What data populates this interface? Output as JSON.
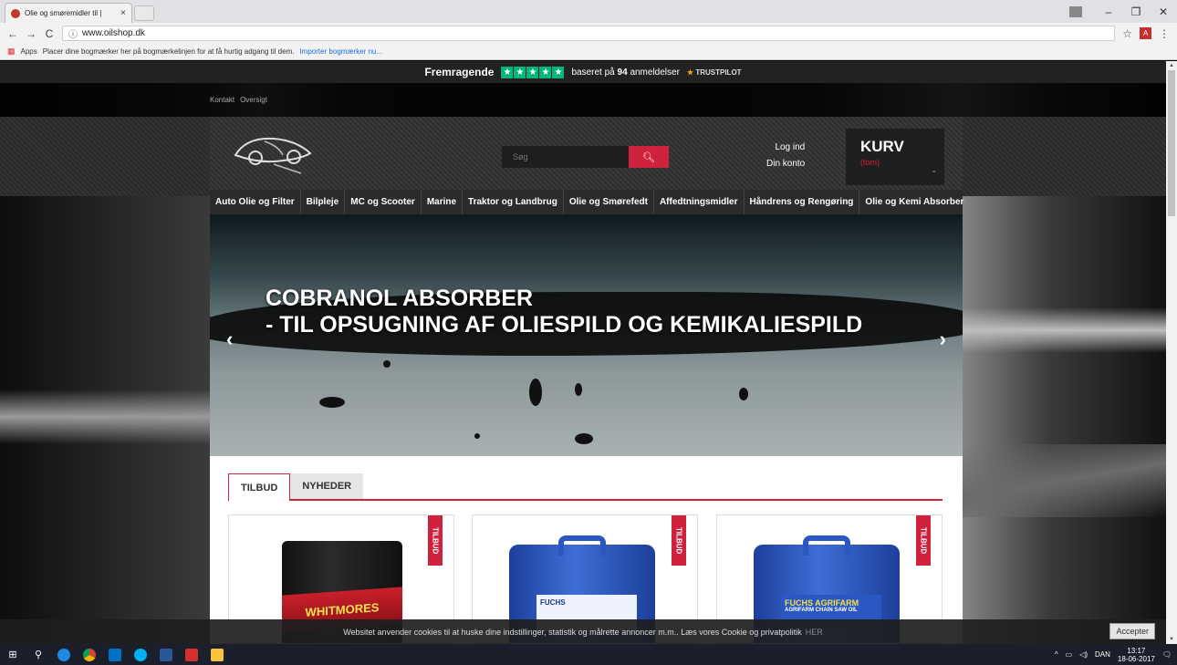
{
  "browser": {
    "tab_title": "Olie og smøremidler til |",
    "tab_close": "×",
    "url": "www.oilshop.dk",
    "info_icon": "info-icon",
    "bookmarks_apps": "Apps",
    "bookmarks_hint": "Placer dine bogmærker her på bogmærkelinjen for at få hurtig adgang til dem.",
    "bookmarks_import": "Importer bogmærker nu..."
  },
  "trustpilot": {
    "excellent": "Fremragende",
    "based_on_prefix": "baseret på",
    "count": "94",
    "based_on_suffix": "anmeldelser",
    "brand": "TRUSTPILOT"
  },
  "toplinks": [
    "Kontakt",
    "Oversigt"
  ],
  "search": {
    "placeholder": "Søg"
  },
  "account": {
    "login": "Log ind",
    "your_account": "Din konto"
  },
  "cart": {
    "title": "KURV",
    "status": "(tom)"
  },
  "menu": [
    "Auto Olie og Filter",
    "Bilpleje",
    "MC og Scooter",
    "Marine",
    "Traktor og Landbrug",
    "Olie og Smørefedt",
    "Affedtningsmidler",
    "Håndrens og Rengøring",
    "Olie og Kemi Absorber"
  ],
  "hero": {
    "line1": "COBRANOL ABSORBER",
    "line2": "- TIL OPSUGNING AF OLIESPILD OG KEMIKALIESPILD"
  },
  "tabs": {
    "active": "TILBUD",
    "inactive": "NYHEDER"
  },
  "products": [
    {
      "badge": "TILBUD",
      "brand": "WHITMORES"
    },
    {
      "badge": "TILBUD",
      "brand": "FUCHS"
    },
    {
      "badge": "TILBUD",
      "brand": "FUCHS AGRIFARM",
      "label": "AGRIFARM CHAIN SAW OIL"
    }
  ],
  "cookie": {
    "text": "Websitet anvender cookies til at huske dine indstillinger, statistik og målrette annoncer m.m.. Læs vores Cookie og privatpolitik",
    "link": "HER",
    "accept": "Accepter"
  },
  "taskbar": {
    "lang": "DAN",
    "time": "13:17",
    "date": "18-06-2017"
  },
  "colors": {
    "accent": "#d0213d",
    "trustpilot_green": "#00b67a"
  }
}
